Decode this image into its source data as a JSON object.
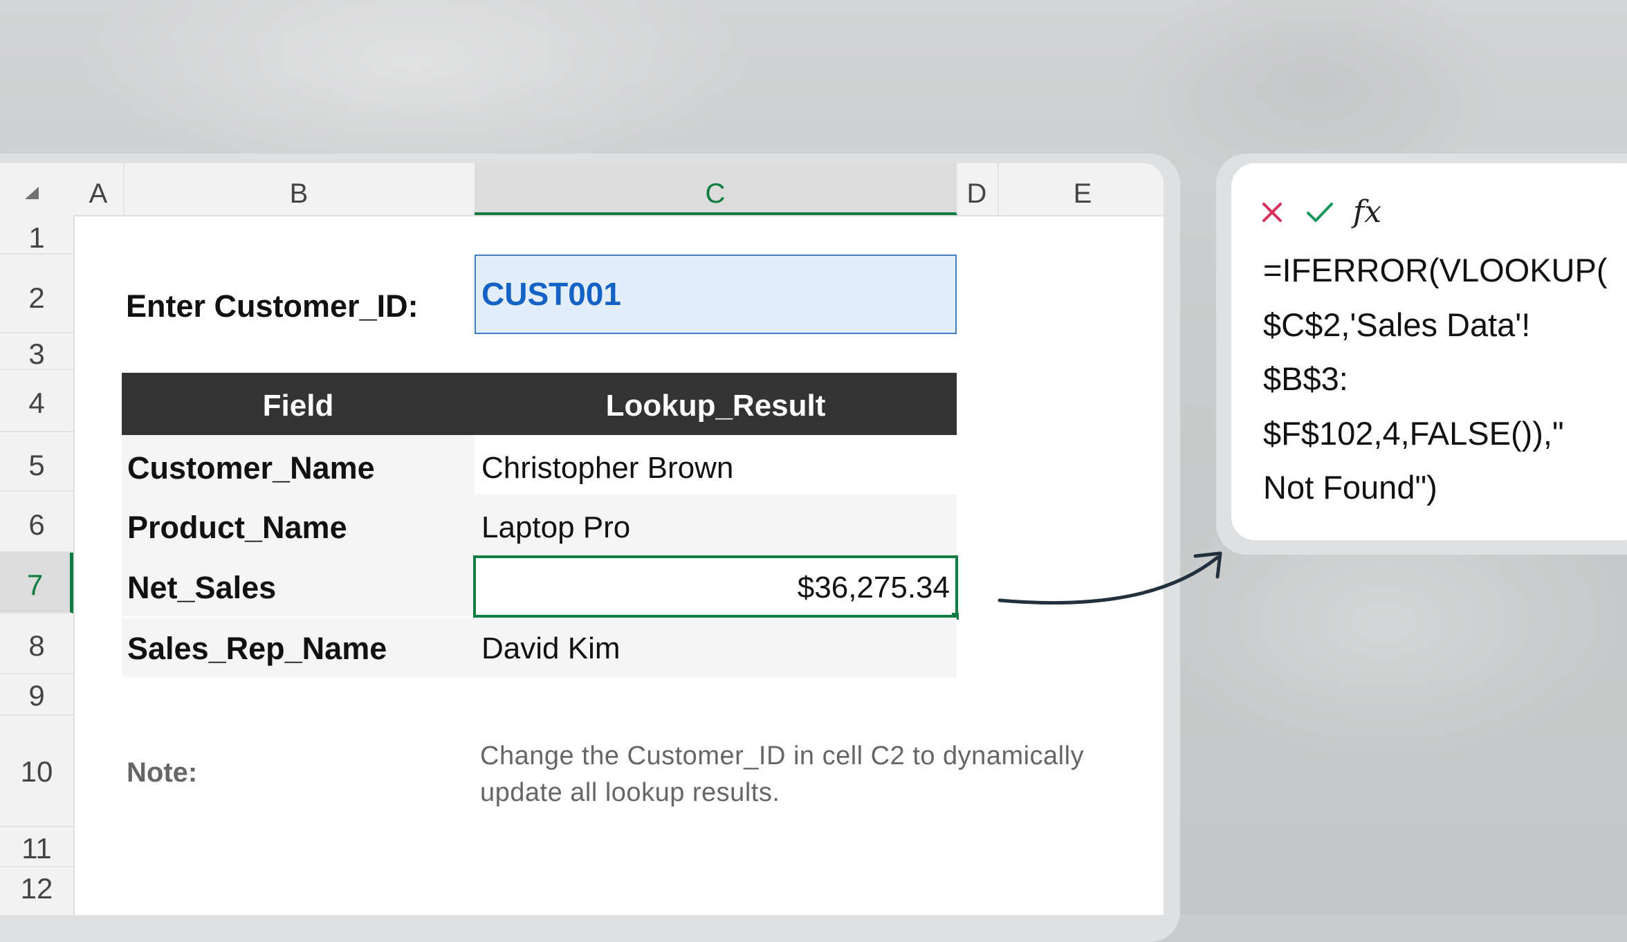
{
  "sheet": {
    "corner_icon": "select-all-triangle",
    "columns": [
      "A",
      "B",
      "C",
      "D",
      "E"
    ],
    "active_column": "C",
    "rows": [
      "1",
      "2",
      "3",
      "4",
      "5",
      "6",
      "7",
      "8",
      "9",
      "10",
      "11",
      "12"
    ],
    "active_row": "7"
  },
  "lookup": {
    "input_label": "Enter Customer_ID:",
    "input_value": "CUST001",
    "headers": [
      "Field",
      "Lookup_Result"
    ],
    "rows": [
      {
        "field": "Customer_Name",
        "result": "Christopher Brown"
      },
      {
        "field": "Product_Name",
        "result": "Laptop Pro"
      },
      {
        "field": "Net_Sales",
        "result": "$36,275.34"
      },
      {
        "field": "Sales_Rep_Name",
        "result": "David Kim"
      }
    ],
    "note_label": "Note:",
    "note_text_line1": "Change the Customer_ID in cell C2 to dynamically",
    "note_text_line2": "update all lookup results."
  },
  "formula_bar": {
    "cancel_icon": "close-icon",
    "confirm_icon": "check-icon",
    "fx_label": "fx",
    "formula_lines": [
      "=IFERROR(VLOOKUP(",
      "$C$2,'Sales Data'!",
      "$B$3:",
      "$F$102,4,FALSE()),\"",
      "Not Found\")"
    ]
  },
  "colors": {
    "accent_green": "#107c41",
    "input_blue": "#1463c4",
    "header_dark": "#333333",
    "cancel_red": "#d4305a",
    "confirm_green": "#14965c"
  }
}
